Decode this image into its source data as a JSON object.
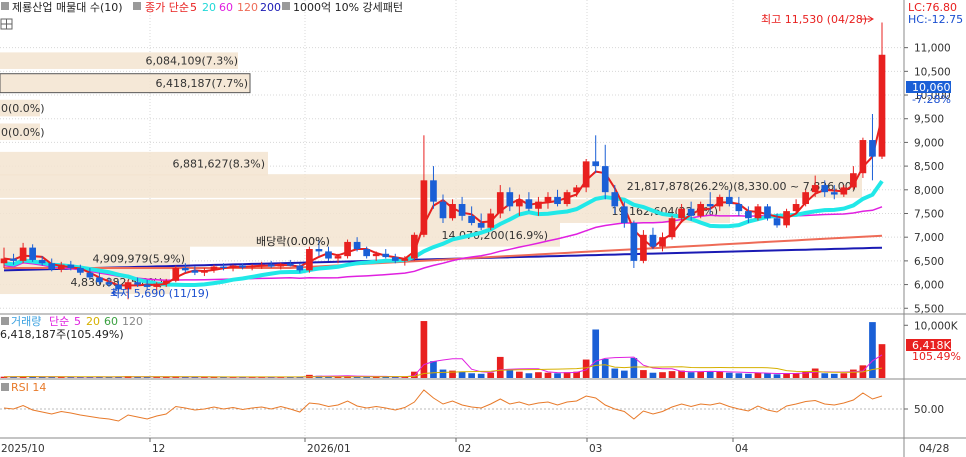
{
  "legend_main": {
    "title": "제룡산업 매물대 수(10)",
    "price_label": "종가 단순",
    "ma": [
      {
        "period": "5",
        "color": "#e8201f"
      },
      {
        "period": "20",
        "color": "#21e8e8"
      },
      {
        "period": "60",
        "color": "#e020e0"
      },
      {
        "period": "120",
        "color": "#ee6b57"
      },
      {
        "period": "200",
        "color": "#1a1ab4"
      }
    ],
    "pattern": "1000억 10% 강세패턴"
  },
  "legend_volume": {
    "title": "거래량",
    "ma_label": "단순",
    "ma": [
      {
        "period": "5",
        "color": "#e020e0"
      },
      {
        "period": "20",
        "color": "#d6b000"
      },
      {
        "period": "60",
        "color": "#3aa040"
      },
      {
        "period": "120",
        "color": "#888888"
      }
    ],
    "last_volume": "6,418,187주(105.49%)"
  },
  "legend_rsi": {
    "title": "RSI 14"
  },
  "top_right": {
    "lc": "LC:76.80",
    "hc": "HC:-12.75"
  },
  "current_price": {
    "value": "10,060",
    "change": "-7.28%"
  },
  "volume_marker": {
    "value": "6,418K",
    "pct": "105.49%"
  },
  "annotations": {
    "high": "최고 11,530 (04/28)",
    "low": "최저 5,690 (11/19)",
    "dividend": "배당락(0.00%)"
  },
  "chart_data": {
    "type": "candlestick",
    "title": "제룡산업",
    "y_range": [
      5400,
      11900
    ],
    "y_ticks": [
      5500,
      6000,
      6500,
      7000,
      7500,
      8000,
      8500,
      9000,
      9500,
      10000,
      10500,
      11000
    ],
    "y_tick_labels": [
      "5,500",
      "6,000",
      "6,500",
      "7,000",
      "7,500",
      "8,000",
      "8,500",
      "9,000",
      "9,500",
      "10,000",
      "10,500",
      "11,000"
    ],
    "x_labels": [
      "2025/10",
      "12",
      "2026/01",
      "02",
      "03",
      "04",
      "04/28"
    ],
    "candles": [
      [
        6450,
        6780,
        6350,
        6550
      ],
      [
        6550,
        6650,
        6420,
        6500
      ],
      [
        6500,
        6880,
        6450,
        6780
      ],
      [
        6780,
        6850,
        6480,
        6520
      ],
      [
        6520,
        6600,
        6400,
        6450
      ],
      [
        6450,
        6550,
        6280,
        6320
      ],
      [
        6320,
        6480,
        6260,
        6420
      ],
      [
        6420,
        6500,
        6300,
        6350
      ],
      [
        6350,
        6420,
        6200,
        6250
      ],
      [
        6250,
        6350,
        6100,
        6150
      ],
      [
        6150,
        6250,
        6000,
        6050
      ],
      [
        6050,
        6150,
        5950,
        6000
      ],
      [
        6000,
        6080,
        5850,
        5900
      ],
      [
        5900,
        6100,
        5690,
        6050
      ],
      [
        6050,
        6150,
        5950,
        6000
      ],
      [
        6000,
        6100,
        5900,
        5950
      ],
      [
        5950,
        6050,
        5880,
        6020
      ],
      [
        6020,
        6120,
        5950,
        6080
      ],
      [
        6080,
        6400,
        6050,
        6350
      ],
      [
        6350,
        6450,
        6250,
        6300
      ],
      [
        6300,
        6380,
        6200,
        6250
      ],
      [
        6250,
        6350,
        6180,
        6300
      ],
      [
        6300,
        6420,
        6250,
        6380
      ],
      [
        6380,
        6450,
        6300,
        6350
      ],
      [
        6350,
        6420,
        6280,
        6400
      ],
      [
        6400,
        6450,
        6320,
        6360
      ],
      [
        6360,
        6430,
        6300,
        6400
      ],
      [
        6400,
        6480,
        6330,
        6420
      ],
      [
        6420,
        6500,
        6350,
        6380
      ],
      [
        6380,
        6460,
        6320,
        6440
      ],
      [
        6440,
        6520,
        6380,
        6400
      ],
      [
        6400,
        6450,
        6250,
        6300
      ],
      [
        6300,
        6800,
        6250,
        6750
      ],
      [
        6750,
        6950,
        6600,
        6700
      ],
      [
        6700,
        6800,
        6500,
        6550
      ],
      [
        6550,
        6650,
        6450,
        6600
      ],
      [
        6600,
        6950,
        6550,
        6900
      ],
      [
        6900,
        7000,
        6700,
        6750
      ],
      [
        6750,
        6800,
        6550,
        6600
      ],
      [
        6600,
        6700,
        6500,
        6650
      ],
      [
        6650,
        6750,
        6550,
        6580
      ],
      [
        6580,
        6650,
        6450,
        6500
      ],
      [
        6500,
        6600,
        6400,
        6550
      ],
      [
        6550,
        7100,
        6500,
        7050
      ],
      [
        7050,
        9150,
        7000,
        8200
      ],
      [
        8200,
        8500,
        7600,
        7750
      ],
      [
        7750,
        7900,
        7300,
        7400
      ],
      [
        7400,
        7800,
        7350,
        7700
      ],
      [
        7700,
        7850,
        7350,
        7450
      ],
      [
        7450,
        7650,
        7250,
        7300
      ],
      [
        7300,
        7500,
        7150,
        7200
      ],
      [
        7200,
        7600,
        7150,
        7500
      ],
      [
        7500,
        8100,
        7400,
        7950
      ],
      [
        7950,
        8050,
        7550,
        7650
      ],
      [
        7650,
        7900,
        7450,
        7800
      ],
      [
        7800,
        7950,
        7550,
        7600
      ],
      [
        7600,
        7850,
        7450,
        7750
      ],
      [
        7750,
        7950,
        7600,
        7850
      ],
      [
        7850,
        8000,
        7650,
        7700
      ],
      [
        7700,
        8000,
        7650,
        7950
      ],
      [
        7950,
        8100,
        7850,
        8050
      ],
      [
        8050,
        8650,
        7950,
        8600
      ],
      [
        8600,
        9150,
        8350,
        8500
      ],
      [
        8500,
        8950,
        7800,
        7950
      ],
      [
        7950,
        8100,
        7500,
        7650
      ],
      [
        7650,
        7750,
        7200,
        7300
      ],
      [
        7300,
        7350,
        6350,
        6500
      ],
      [
        6500,
        7150,
        6450,
        7050
      ],
      [
        7050,
        7200,
        6750,
        6800
      ],
      [
        6800,
        7100,
        6700,
        7000
      ],
      [
        7000,
        7450,
        6950,
        7400
      ],
      [
        7400,
        7700,
        7300,
        7600
      ],
      [
        7600,
        7750,
        7350,
        7450
      ],
      [
        7450,
        7750,
        7400,
        7700
      ],
      [
        7700,
        7950,
        7500,
        7650
      ],
      [
        7650,
        7900,
        7550,
        7850
      ],
      [
        7850,
        8000,
        7650,
        7700
      ],
      [
        7700,
        7850,
        7450,
        7550
      ],
      [
        7550,
        7650,
        7300,
        7400
      ],
      [
        7400,
        7700,
        7350,
        7650
      ],
      [
        7650,
        7700,
        7350,
        7400
      ],
      [
        7400,
        7500,
        7200,
        7250
      ],
      [
        7250,
        7600,
        7200,
        7550
      ],
      [
        7550,
        7800,
        7500,
        7700
      ],
      [
        7700,
        8000,
        7650,
        7950
      ],
      [
        7950,
        8300,
        7850,
        8100
      ],
      [
        8100,
        8200,
        7850,
        7950
      ],
      [
        7950,
        8100,
        7800,
        7900
      ],
      [
        7900,
        8100,
        7850,
        8050
      ],
      [
        8050,
        8500,
        8000,
        8350
      ],
      [
        8350,
        9100,
        8250,
        9050
      ],
      [
        9050,
        9600,
        8200,
        8700
      ],
      [
        8700,
        11530,
        8650,
        10850
      ]
    ],
    "ma5_color": "#e8201f",
    "ma20_color": "#21e8e8",
    "ma60_color": "#e020e0",
    "ma120_color": "#ee6b57",
    "ma200_color": "#1a1ab4",
    "volume_profile": [
      {
        "label": "6,084,109(7.3%)",
        "price_low": 10550,
        "price_high": 10900
      },
      {
        "label": "6,418,187(7.7%)",
        "price_low": 10050,
        "price_high": 10450
      },
      {
        "label": "0(0.0%)",
        "price_low": 9550,
        "price_high": 9900
      },
      {
        "label": "0(0.0%)",
        "price_low": 9050,
        "price_high": 9400
      },
      {
        "label": "6,881,627(8.3%)",
        "price_low": 8300,
        "price_high": 8800
      },
      {
        "label": "21,817,878(26.2%)(8,330.00 ~ 7,826.00)",
        "price_low": 7830,
        "price_high": 8330
      },
      {
        "label": "19,162,604(22.9%)",
        "price_low": 7300,
        "price_high": 7800
      },
      {
        "label": "14,070,200(16.9%)",
        "price_low": 6800,
        "price_high": 7300
      },
      {
        "label": "4,909,979(5.9%)",
        "price_low": 6300,
        "price_high": 6800
      },
      {
        "label": "4,830,882(5.8%)",
        "price_low": 5800,
        "price_high": 6300
      }
    ],
    "volume": {
      "y_range": [
        0,
        11000
      ],
      "y_ticks_label": "10,000K",
      "values": [
        250,
        220,
        300,
        260,
        200,
        180,
        190,
        170,
        230,
        210,
        200,
        190,
        240,
        380,
        220,
        180,
        170,
        190,
        320,
        210,
        180,
        170,
        200,
        180,
        170,
        160,
        180,
        190,
        170,
        180,
        190,
        230,
        600,
        420,
        320,
        280,
        450,
        300,
        260,
        240,
        220,
        260,
        230,
        1200,
        10800,
        3200,
        1600,
        1400,
        1200,
        900,
        800,
        1000,
        4000,
        1600,
        1200,
        900,
        1100,
        1000,
        900,
        1100,
        1200,
        3500,
        9200,
        3600,
        1800,
        1400,
        3800,
        1500,
        1000,
        1100,
        1300,
        1400,
        1100,
        1200,
        1300,
        1200,
        1000,
        900,
        800,
        1000,
        900,
        700,
        900,
        900,
        1300,
        1800,
        900,
        800,
        900,
        1600,
        2400,
        10600,
        6418
      ]
    },
    "rsi": {
      "y_range": [
        0,
        100
      ],
      "tick": "50.00",
      "values": [
        52,
        50,
        57,
        48,
        44,
        40,
        45,
        42,
        38,
        35,
        32,
        30,
        26,
        38,
        34,
        30,
        36,
        40,
        55,
        52,
        48,
        50,
        54,
        50,
        53,
        49,
        52,
        54,
        50,
        55,
        50,
        44,
        62,
        60,
        55,
        58,
        66,
        56,
        52,
        55,
        52,
        48,
        53,
        64,
        88,
        72,
        60,
        66,
        58,
        54,
        52,
        60,
        70,
        60,
        64,
        58,
        62,
        64,
        58,
        64,
        66,
        76,
        72,
        58,
        50,
        45,
        30,
        46,
        40,
        45,
        54,
        60,
        55,
        60,
        58,
        62,
        55,
        50,
        46,
        56,
        48,
        44,
        56,
        60,
        65,
        67,
        60,
        58,
        62,
        68,
        82,
        70,
        76
      ]
    }
  }
}
